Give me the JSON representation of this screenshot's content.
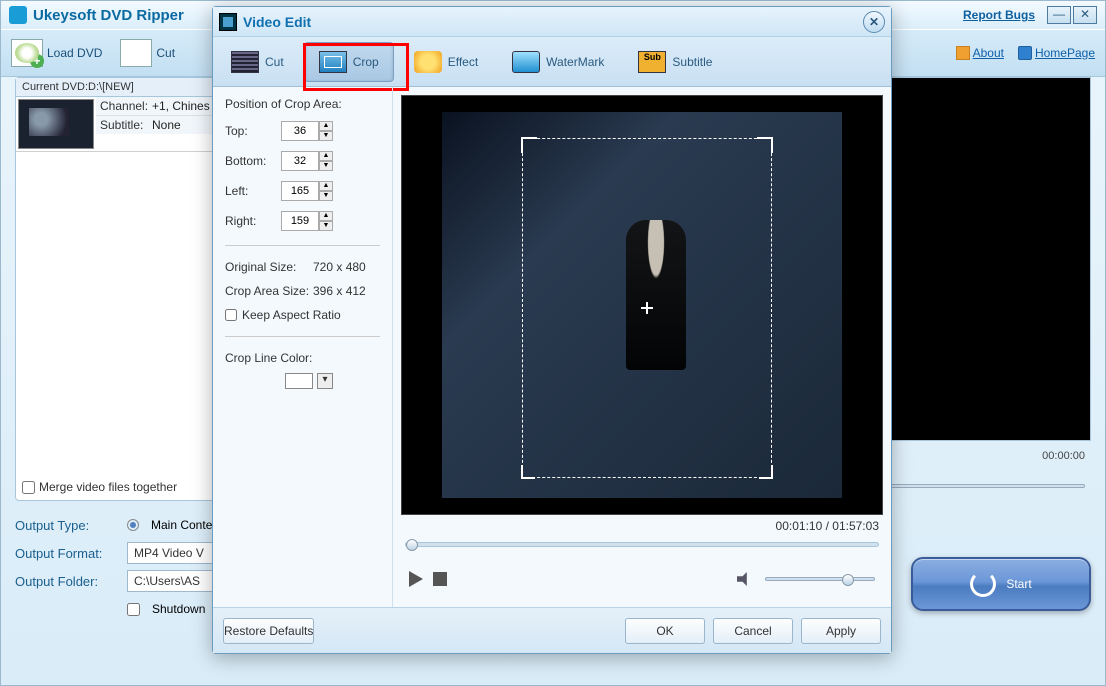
{
  "app": {
    "title": "Ukeysoft DVD Ripper",
    "report_bugs": "Report Bugs"
  },
  "toolbar": {
    "load_dvd": "Load DVD",
    "cut": "Cut",
    "about": "About",
    "homepage": "HomePage"
  },
  "dvd": {
    "header": "Current DVD:D:\\[NEW]",
    "channel_label": "Channel:",
    "channel_value": "+1, Chines",
    "subtitle_label": "Subtitle:",
    "subtitle_value": "None"
  },
  "merge_label": "Merge video files together",
  "preview": {
    "elapsed": "00:00:00"
  },
  "form": {
    "output_type_label": "Output Type:",
    "output_type_value": "Main Conte",
    "output_format_label": "Output Format:",
    "output_format_value": "MP4 Video V",
    "output_folder_label": "Output Folder:",
    "output_folder_value": "C:\\Users\\AS",
    "shutdown_label": "Shutdown"
  },
  "start": "Start",
  "dialog": {
    "title": "Video Edit",
    "tabs": {
      "cut": "Cut",
      "crop": "Crop",
      "effect": "Effect",
      "watermark": "WaterMark",
      "subtitle": "Subtitle"
    },
    "crop": {
      "pos_title": "Position of Crop Area:",
      "top_label": "Top:",
      "top_value": "36",
      "bottom_label": "Bottom:",
      "bottom_value": "32",
      "left_label": "Left:",
      "left_value": "165",
      "right_label": "Right:",
      "right_value": "159",
      "orig_label": "Original Size:",
      "orig_value": "720 x 480",
      "area_label": "Crop Area Size:",
      "area_value": "396 x 412",
      "keep_ar": "Keep Aspect Ratio",
      "line_color": "Crop Line Color:"
    },
    "time": {
      "current": "00:01:10",
      "sep": " / ",
      "total": "01:57:03"
    },
    "buttons": {
      "restore": "Restore Defaults",
      "ok": "OK",
      "cancel": "Cancel",
      "apply": "Apply"
    }
  }
}
